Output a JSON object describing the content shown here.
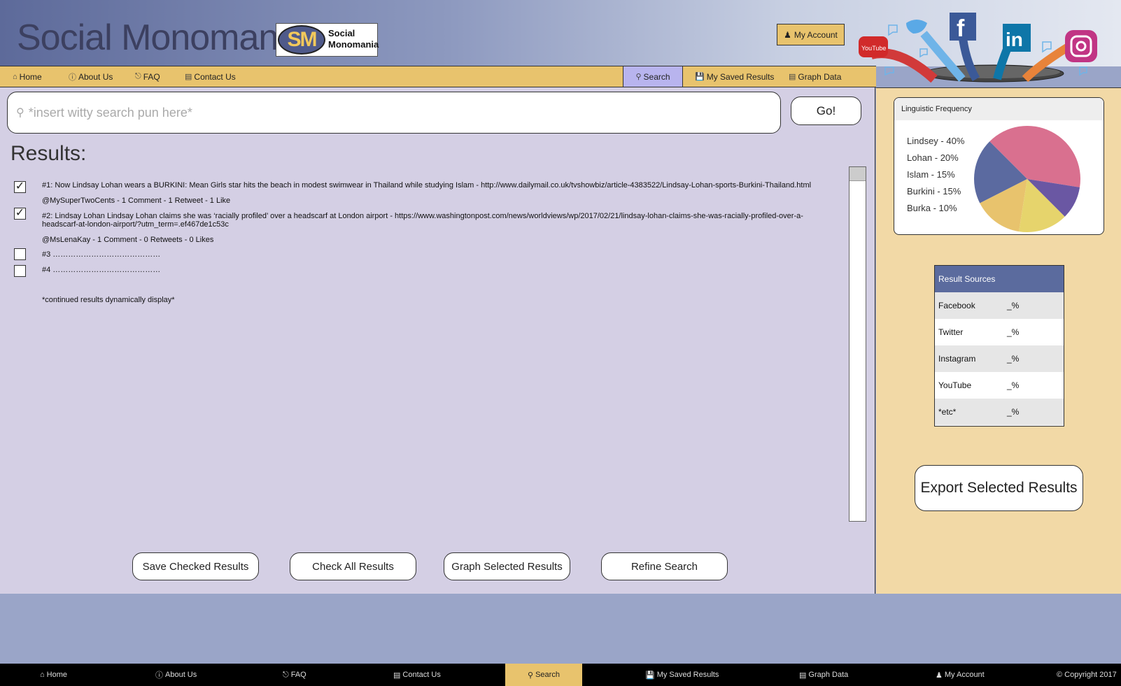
{
  "header": {
    "site_title": "Social Monomania",
    "logo_mark": "SM",
    "logo_text_line1": "Social",
    "logo_text_line2": "Monomania",
    "account_button": "My Account"
  },
  "nav": {
    "items": [
      {
        "label": "Home",
        "icon": "home-icon"
      },
      {
        "label": "About Us",
        "icon": "info-icon"
      },
      {
        "label": "FAQ",
        "icon": "question-icon"
      },
      {
        "label": "Contact Us",
        "icon": "contact-icon"
      },
      {
        "label": "Search",
        "icon": "search-icon"
      },
      {
        "label": "My Saved Results",
        "icon": "save-icon"
      },
      {
        "label": "Graph Data",
        "icon": "graph-icon"
      }
    ],
    "active": "Search"
  },
  "search": {
    "placeholder": "*insert witty search pun here*",
    "go_label": "Go!"
  },
  "results": {
    "heading": "Results:",
    "items": [
      {
        "checked": true,
        "text": "#1: Now Lindsay Lohan wears a BURKINI: Mean Girls star hits the beach in modest swimwear in Thailand while studying Islam - http://www.dailymail.co.uk/tvshowbiz/article-4383522/Lindsay-Lohan-sports-Burkini-Thailand.html",
        "meta": "@MySuperTwoCents - 1 Comment - 1 Retweet - 1 Like"
      },
      {
        "checked": true,
        "text": "#2: Lindsay Lohan  Lindsay Lohan claims she was ‘racially profiled’ over a headscarf at London airport - https://www.washingtonpost.com/news/worldviews/wp/2017/02/21/lindsay-lohan-claims-she-was-racially-profiled-over-a-headscarf-at-london-airport/?utm_term=.ef467de1c53c",
        "meta": "@MsLenaKay - 1 Comment - 0 Retweets - 0 Likes"
      },
      {
        "checked": false,
        "text": "#3 ……………………………………"
      },
      {
        "checked": false,
        "text": "#4 ……………………………………"
      }
    ],
    "continued_note": "*continued results dynamically display*"
  },
  "actions": {
    "save_checked": "Save Checked Results",
    "check_all": "Check All Results",
    "graph_selected": "Graph Selected Results",
    "refine": "Refine Search"
  },
  "sidebar": {
    "freq_title": "Linguistic Frequency",
    "freq_items": [
      {
        "label": "Lindsey - 40%",
        "value": 40,
        "color": "#d9708f"
      },
      {
        "label": "Lohan - 20%",
        "value": 20,
        "color": "#5b6aa0"
      },
      {
        "label": "Islam - 15%",
        "value": 15,
        "color": "#e8c36d"
      },
      {
        "label": "Burkini - 15%",
        "value": 15,
        "color": "#e6d46c"
      },
      {
        "label": "Burka - 10%",
        "value": 10,
        "color": "#6a57a3"
      }
    ],
    "sources_title": "Result Sources",
    "sources": [
      {
        "name": "Facebook",
        "pct": "_%"
      },
      {
        "name": "Twitter",
        "pct": "_%"
      },
      {
        "name": "Instagram",
        "pct": "_%"
      },
      {
        "name": "YouTube",
        "pct": "_%"
      },
      {
        "name": "*etc*",
        "pct": "_%"
      }
    ],
    "export_label": "Export Selected Results"
  },
  "footer": {
    "items": [
      "Home",
      "About Us",
      "FAQ",
      "Contact Us",
      "Search",
      "My Saved Results",
      "Graph Data",
      "My Account"
    ],
    "copyright": "© Copyright 2017"
  },
  "social_art_labels": {
    "youtube": "YouTube",
    "facebook": "f",
    "linkedin": "in"
  },
  "colors": {
    "accent": "#e8c36d",
    "nav_active": "#b8b4ee",
    "brand": "#5b6b9e"
  }
}
